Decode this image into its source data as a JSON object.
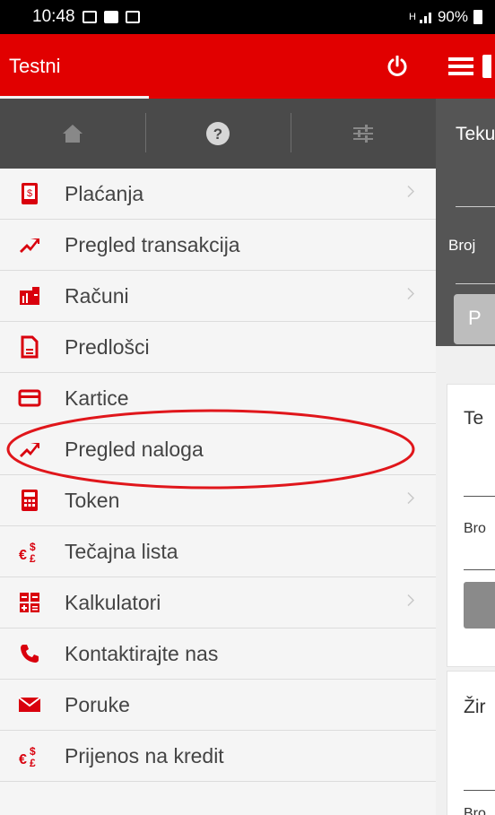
{
  "status_bar": {
    "time": "10:48",
    "signal_label": "H",
    "battery": "90%"
  },
  "drawer": {
    "title": "Testni",
    "menu": [
      {
        "label": "Plaćanja",
        "icon": "mobile-payment-icon",
        "has_submenu": true
      },
      {
        "label": "Pregled transakcija",
        "icon": "transactions-icon",
        "has_submenu": false
      },
      {
        "label": "Računi",
        "icon": "accounts-icon",
        "has_submenu": true
      },
      {
        "label": "Predlošci",
        "icon": "document-icon",
        "has_submenu": false
      },
      {
        "label": "Kartice",
        "icon": "card-icon",
        "has_submenu": false
      },
      {
        "label": "Pregled naloga",
        "icon": "orders-icon",
        "has_submenu": false,
        "highlighted": true
      },
      {
        "label": "Token",
        "icon": "calculator-icon",
        "has_submenu": true
      },
      {
        "label": "Tečajna lista",
        "icon": "currency-icon",
        "has_submenu": false
      },
      {
        "label": "Kalkulatori",
        "icon": "calculators-icon",
        "has_submenu": true
      },
      {
        "label": "Kontaktirajte nas",
        "icon": "phone-icon",
        "has_submenu": false
      },
      {
        "label": "Poruke",
        "icon": "mail-icon",
        "has_submenu": false
      },
      {
        "label": "Prijenos na kredit",
        "icon": "currency-transfer-icon",
        "has_submenu": false
      }
    ]
  },
  "background_panel": {
    "section1_title": "Teku",
    "section1_sub": "Broj",
    "section1_button": "P",
    "card1_title": "Te",
    "card1_sub": "Bro",
    "card2_title": "Žir",
    "card2_sub": "Bro"
  },
  "colors": {
    "brand_red": "#e10000",
    "icon_red": "#d9000d",
    "gray_bar": "#4a4a4a"
  }
}
